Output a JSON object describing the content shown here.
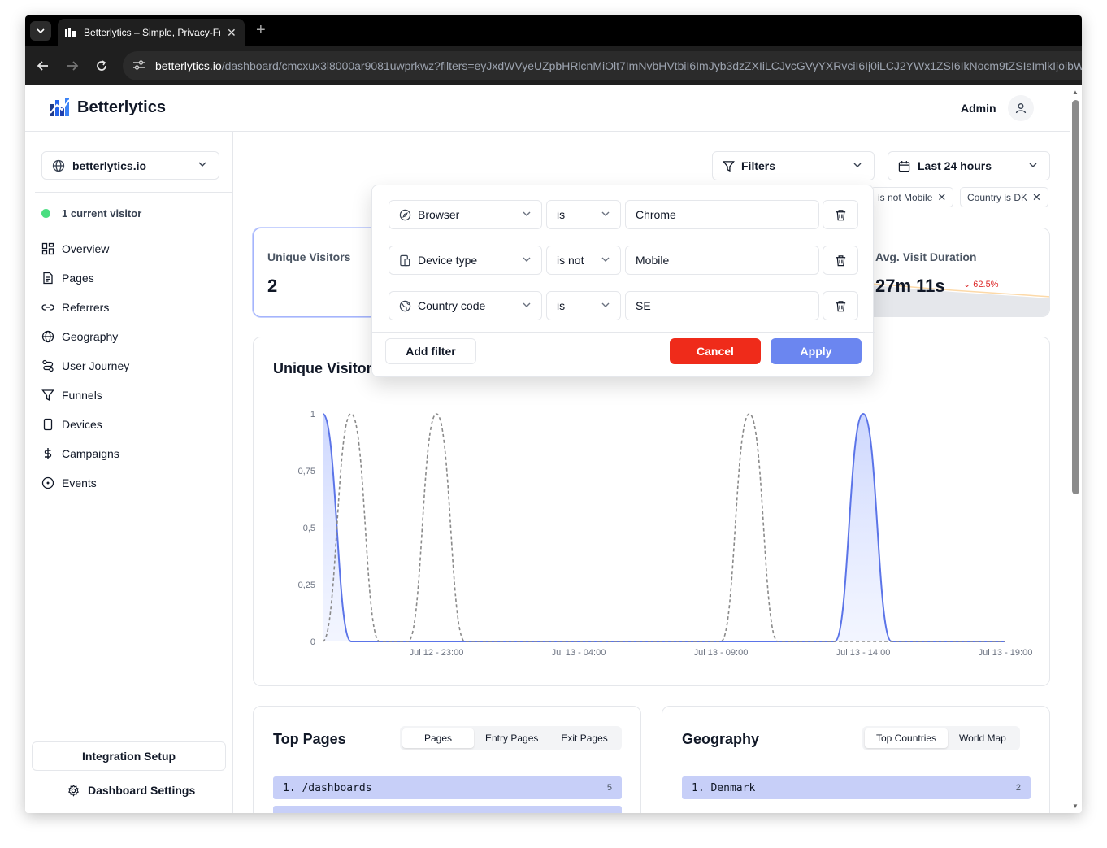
{
  "browser": {
    "tab_title": "Betterlytics – Simple, Privacy-Fri",
    "url_host": "betterlytics.io",
    "url_path": "/dashboard/cmcxux3l8000ar9081uwprkwz?filters=eyJxdWVyeUZpbHRlcnMiOlt7ImNvbHVtbiI6ImJyb3dzZXIiLCJvcGVyYXRvciI6Ij0iLCJ2YWx1ZSI6IkNocm9tZSIsImlkIjoibWQxeW"
  },
  "header": {
    "brand": "Betterlytics",
    "user": "Admin"
  },
  "sidebar": {
    "site": "betterlytics.io",
    "visitor_status": "1 current visitor",
    "items": [
      {
        "label": "Overview"
      },
      {
        "label": "Pages"
      },
      {
        "label": "Referrers"
      },
      {
        "label": "Geography"
      },
      {
        "label": "User Journey"
      },
      {
        "label": "Funnels"
      },
      {
        "label": "Devices"
      },
      {
        "label": "Campaigns"
      },
      {
        "label": "Events"
      }
    ],
    "integration_setup": "Integration Setup",
    "dashboard_settings": "Dashboard Settings"
  },
  "toolbar": {
    "filters_label": "Filters",
    "range_label": "Last 24 hours",
    "chips": [
      "is not Mobile",
      "Country is DK"
    ]
  },
  "stats": {
    "unique_visitors_label": "Unique Visitors",
    "unique_visitors_value": "2",
    "avg_duration_label": "Avg. Visit Duration",
    "avg_duration_value": "27m 11s",
    "avg_duration_change": "62.5%"
  },
  "filter_popup": {
    "rows": [
      {
        "column": "Browser",
        "operator": "is",
        "value": "Chrome"
      },
      {
        "column": "Device type",
        "operator": "is not",
        "value": "Mobile"
      },
      {
        "column": "Country code",
        "operator": "is",
        "value": "SE"
      }
    ],
    "add_filter": "Add filter",
    "cancel": "Cancel",
    "apply": "Apply"
  },
  "chart_data": {
    "type": "area",
    "title": "Unique Visitors",
    "y_ticks": [
      "1",
      "0,75",
      "0,5",
      "0,25",
      "0"
    ],
    "x_ticks": [
      "Jul 12 - 23:00",
      "Jul 13 - 04:00",
      "Jul 13 - 09:00",
      "Jul 13 - 14:00",
      "Jul 13 - 19:00"
    ],
    "ylim": [
      0,
      1
    ],
    "series": [
      {
        "style": "solid-area",
        "color": "#5b74e8",
        "points": [
          [
            0,
            1
          ],
          [
            1,
            0
          ],
          [
            2,
            0
          ],
          [
            3,
            0
          ],
          [
            4,
            0
          ],
          [
            5,
            0
          ],
          [
            6,
            0
          ],
          [
            7,
            0
          ],
          [
            8,
            0
          ],
          [
            9,
            0
          ],
          [
            10,
            0
          ],
          [
            11,
            0
          ],
          [
            12,
            0
          ],
          [
            13,
            0
          ],
          [
            14,
            0
          ],
          [
            15,
            0
          ],
          [
            16,
            0
          ],
          [
            17,
            0
          ],
          [
            18,
            0
          ],
          [
            19,
            1
          ],
          [
            20,
            0
          ],
          [
            21,
            0
          ],
          [
            22,
            0
          ],
          [
            23,
            0
          ],
          [
            24,
            0
          ]
        ]
      },
      {
        "style": "dashed",
        "color": "#8a8a8a",
        "points": [
          [
            0,
            0
          ],
          [
            1,
            1
          ],
          [
            2,
            0
          ],
          [
            3,
            0
          ],
          [
            4,
            1
          ],
          [
            5,
            0
          ],
          [
            6,
            0
          ],
          [
            7,
            0
          ],
          [
            8,
            0
          ],
          [
            9,
            0
          ],
          [
            10,
            0
          ],
          [
            11,
            0
          ],
          [
            12,
            0
          ],
          [
            13,
            0
          ],
          [
            14,
            0
          ],
          [
            15,
            1
          ],
          [
            16,
            0
          ],
          [
            17,
            0
          ],
          [
            18,
            0
          ],
          [
            19,
            0
          ],
          [
            20,
            0
          ],
          [
            21,
            0
          ],
          [
            22,
            0
          ],
          [
            23,
            0
          ],
          [
            24,
            0
          ]
        ]
      }
    ]
  },
  "top_pages": {
    "title": "Top Pages",
    "tabs": [
      "Pages",
      "Entry Pages",
      "Exit Pages"
    ],
    "rows": [
      {
        "rank": "1.",
        "path": "/dashboards",
        "count": "5"
      }
    ]
  },
  "geography": {
    "title": "Geography",
    "tabs": [
      "Top Countries",
      "World Map"
    ],
    "rows": [
      {
        "rank": "1.",
        "name": "Denmark",
        "count": "2"
      }
    ]
  },
  "colors": {
    "accent": "#6b86f0",
    "danger": "#ef2b1a",
    "online": "#4ade80",
    "bar": "#c7cff8"
  }
}
